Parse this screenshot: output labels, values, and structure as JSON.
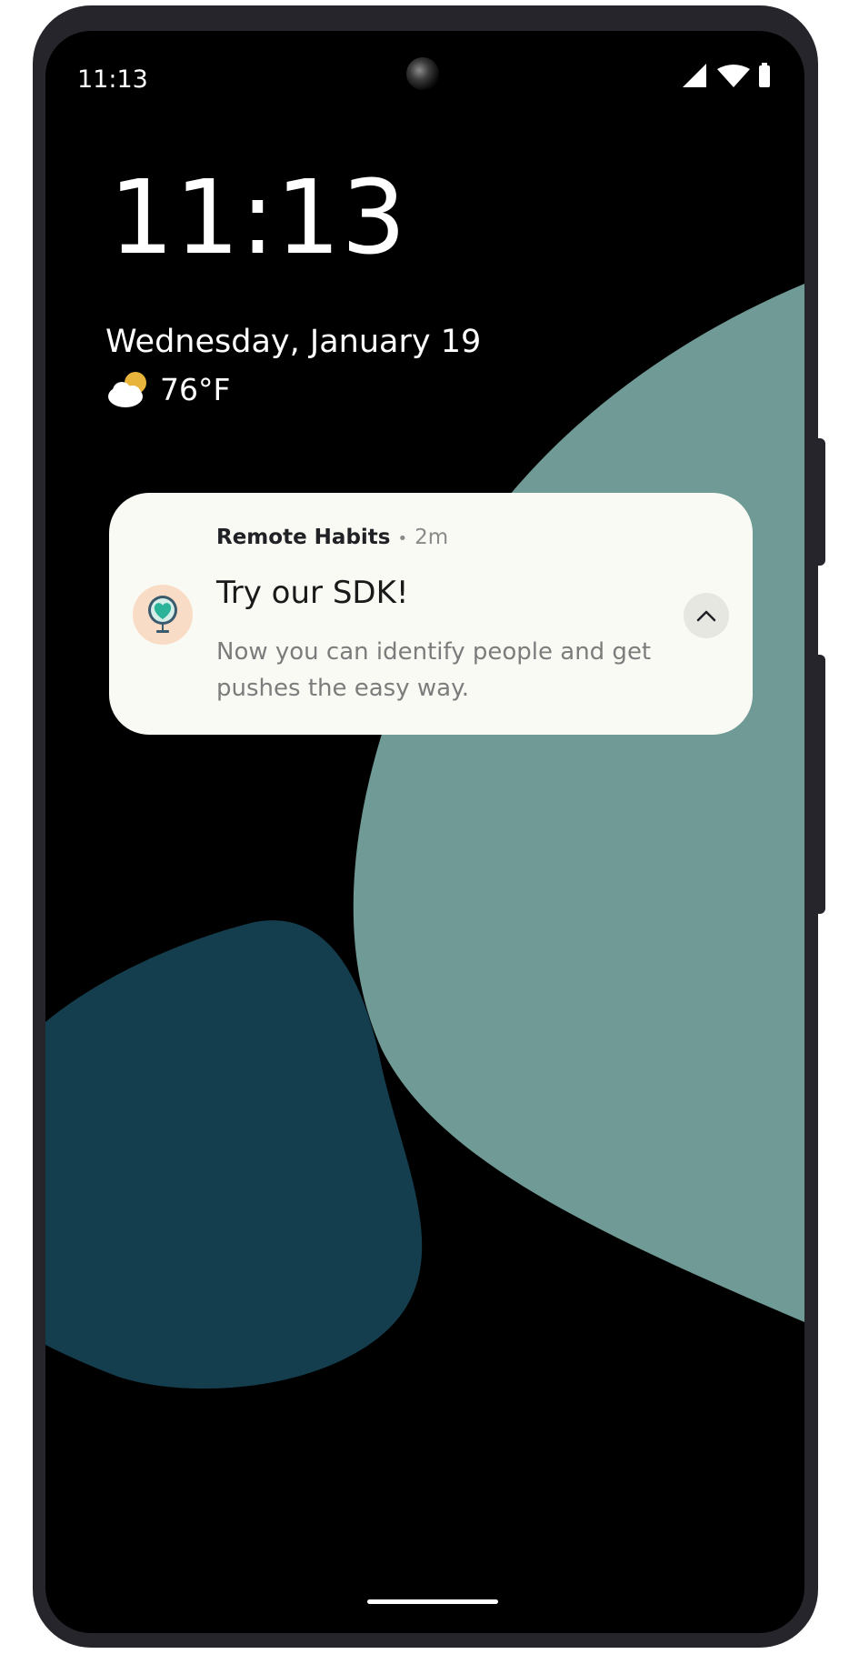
{
  "status_bar": {
    "time": "11:13",
    "icons": [
      "signal-icon",
      "wifi-icon",
      "battery-icon"
    ]
  },
  "lock_screen": {
    "clock": "11:13",
    "date": "Wednesday, January 19",
    "weather": {
      "icon": "partly-cloudy-icon",
      "temperature": "76°F"
    }
  },
  "notification": {
    "app_name": "Remote Habits",
    "separator": "•",
    "time_ago": "2m",
    "title": "Try our SDK!",
    "body": "Now you can identify people and get pushes the easy way.",
    "app_icon": "globe-heart-icon",
    "expand_icon": "chevron-up-icon"
  },
  "colors": {
    "wallpaper_teal": "#6f9a95",
    "wallpaper_navy": "#143d4d",
    "notification_bg": "#fafaf5",
    "app_icon_bg": "#f9dcc6"
  }
}
